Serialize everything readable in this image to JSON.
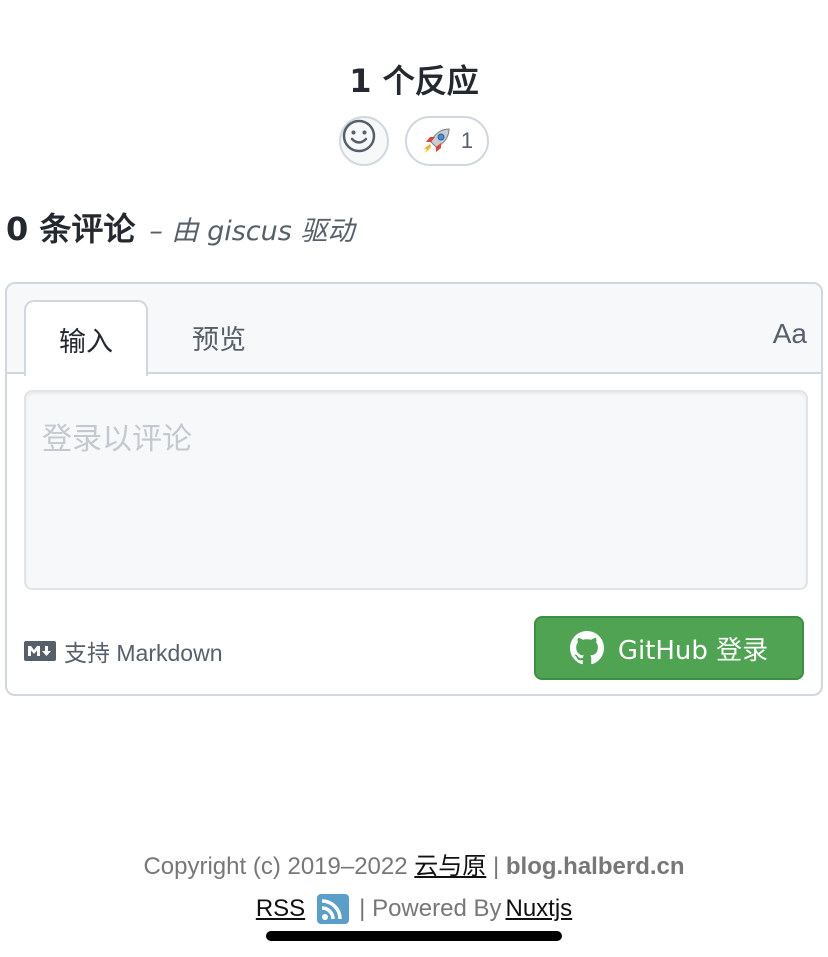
{
  "reactions": {
    "title": "1 个反应",
    "add_icon": "smiley-icon",
    "items": [
      {
        "emoji": "🚀",
        "icon": "rocket-icon",
        "count": "1"
      }
    ]
  },
  "comments": {
    "count_label": "0 条评论",
    "powered_by": "– 由 giscus 驱动"
  },
  "editor": {
    "tabs": [
      {
        "label": "输入",
        "active": true
      },
      {
        "label": "预览",
        "active": false
      }
    ],
    "font_toggle": "Aa",
    "placeholder": "登录以评论",
    "markdown_hint": "支持 Markdown",
    "login_button": "GitHub 登录"
  },
  "footer": {
    "copyright": "Copyright (c) 2019–2022",
    "site_name": "云与原",
    "separator": "|",
    "domain": "blog.halberd.cn",
    "rss": "RSS",
    "powered_prefix": "| Powered By",
    "framework": "Nuxtjs"
  },
  "colors": {
    "primary_button": "#4fa352",
    "border": "#d0d7de",
    "muted_text": "#57606a",
    "footer_text": "#777777",
    "rss": "#5b9fc9"
  }
}
